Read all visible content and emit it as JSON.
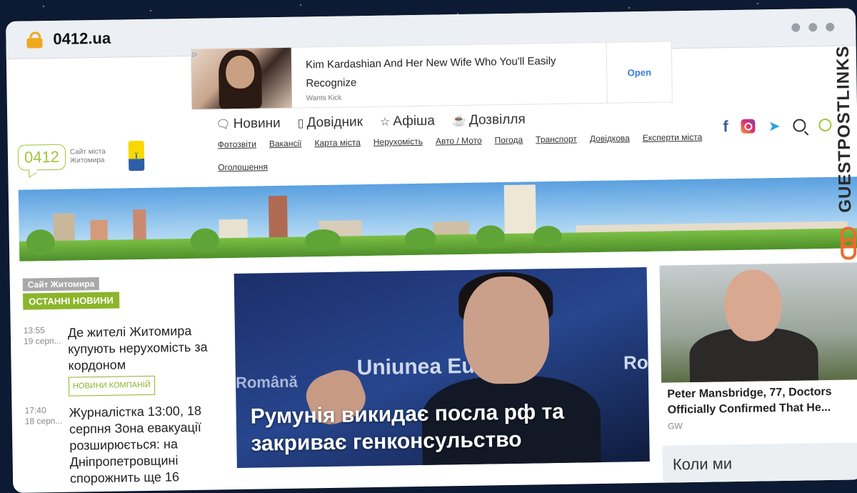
{
  "browser": {
    "url": "0412.ua"
  },
  "ad_top": {
    "adchoices": "▷",
    "title": "Kim Kardashian And Her New Wife Who You'll Easily Recognize",
    "source": "Wants Kick",
    "cta": "Open"
  },
  "site": {
    "logo_text": "0412",
    "logo_sub": "Сайт міста Житомира",
    "flag_text": "ї"
  },
  "nav": {
    "main": [
      "Новини",
      "Довідник",
      "Афіша",
      "Дозвілля"
    ],
    "sub": [
      "Фотозвіти",
      "Вакансії",
      "Карта міста",
      "Нерухомість",
      "Авто / Мото",
      "Погода",
      "Транспорт",
      "Довідкова",
      "Експерти міста",
      "Оголошення"
    ]
  },
  "left": {
    "label_site": "Сайт Житомира",
    "label_latest": "ОСТАННІ НОВИНИ",
    "news": [
      {
        "time": "13:55",
        "date": "19 серп...",
        "title": "Де жителі Житомира купують нерухомість за кордоном",
        "tag": "НОВИНИ КОМПАНІЙ"
      },
      {
        "time": "17:40",
        "date": "18 серп...",
        "title": "Журналістка 13:00, 18 серпня Зона евакуації розширюється: на Дніпропетровщині спорожнить ще 16",
        "tag": ""
      }
    ]
  },
  "hero": {
    "bg_text_1": "Uniunea Eu",
    "bg_text_2": "Română",
    "bg_text_3": "Ro",
    "caption": "Румунія викидає посла рф та закриває генконсульство"
  },
  "right_ad": {
    "title": "Peter Mansbridge, 77, Doctors Officially Confirmed That He...",
    "source": "GW",
    "box_title": "Коли ми"
  },
  "watermark": {
    "text": "GUESTPOSTLINKS"
  },
  "colors": {
    "brand_green": "#8bb52a",
    "link_blue": "#3a7bd5",
    "facebook": "#3b5998",
    "telegram": "#2aa3de",
    "watermark_orange": "#ef6a2d"
  }
}
